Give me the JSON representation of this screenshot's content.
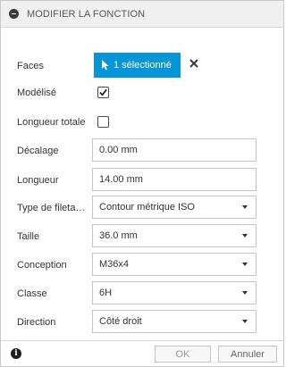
{
  "header": {
    "title": "MODIFIER LA FONCTION"
  },
  "rows": {
    "faces": {
      "label": "Faces",
      "button_label": "1 sélectionné",
      "clear_icon": "close-icon"
    },
    "modelise": {
      "label": "Modélisé",
      "checked": true
    },
    "longueur_totale": {
      "label": "Longueur totale",
      "checked": false
    },
    "decalage": {
      "label": "Décalage",
      "value": "0.00 mm"
    },
    "longueur": {
      "label": "Longueur",
      "value": "14.00 mm"
    },
    "type_filetage": {
      "label": "Type de fileta…",
      "value": "Contour métrique ISO"
    },
    "taille": {
      "label": "Taille",
      "value": "36.0 mm"
    },
    "conception": {
      "label": "Conception",
      "value": "M36x4"
    },
    "classe": {
      "label": "Classe",
      "value": "6H"
    },
    "direction": {
      "label": "Direction",
      "value": "Côté droit"
    }
  },
  "footer": {
    "ok_label": "OK",
    "cancel_label": "Annuler",
    "info_icon": "info-icon"
  },
  "colors": {
    "accent": "#0696d7",
    "header_bg": "#f0f0f0",
    "border": "#c4c4c4"
  }
}
